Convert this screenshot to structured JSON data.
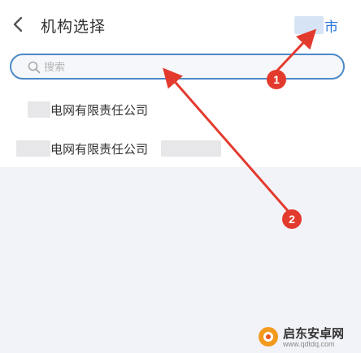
{
  "header": {
    "back_icon": "chevron-left-icon",
    "title": "机构选择",
    "city_suffix": "市"
  },
  "search": {
    "icon": "search-icon",
    "placeholder": "搜索"
  },
  "list": {
    "items": [
      {
        "label": "电网有限责任公司"
      },
      {
        "label": "电网有限责任公司"
      }
    ]
  },
  "annotations": {
    "badges": [
      "1",
      "2"
    ],
    "arrow_color": "#e33a2e"
  },
  "watermark": {
    "title": "启东安卓网",
    "url": "www.qdtdq.com"
  },
  "colors": {
    "accent": "#2d7be0",
    "search_border": "#4c89c8",
    "background": "#f2f3f8"
  }
}
